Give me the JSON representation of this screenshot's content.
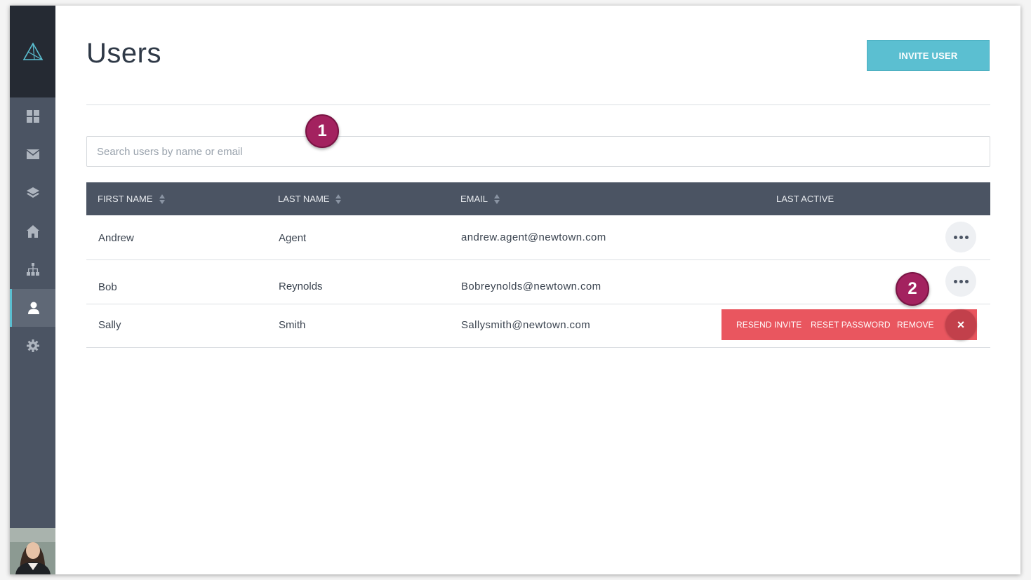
{
  "page": {
    "title": "Users"
  },
  "header": {
    "invite_label": "INVITE USER"
  },
  "search": {
    "placeholder": "Search users by name or email",
    "value": ""
  },
  "table": {
    "columns": [
      "FIRST NAME",
      "LAST NAME",
      "EMAIL",
      "LAST ACTIVE"
    ],
    "rows": [
      {
        "first": "Andrew",
        "last": "Agent",
        "email": "andrew.agent@newtown.com",
        "last_active": ""
      },
      {
        "first": "Bob",
        "last": "Reynolds",
        "email": "Bobreynolds@newtown.com",
        "last_active": ""
      },
      {
        "first": "Sally",
        "last": "Smith",
        "email": "Sallysmith@newtown.com",
        "last_active": ""
      }
    ]
  },
  "row_actions": {
    "resend": "RESEND INVITE",
    "reset": "RESET PASSWORD",
    "remove": "REMOVE",
    "close": "×"
  },
  "markers": [
    "1",
    "2"
  ],
  "sidebar": {
    "items": [
      "dashboard-icon",
      "mail-icon",
      "layers-icon",
      "home-icon",
      "org-chart-icon",
      "user-icon",
      "gear-icon"
    ],
    "active_item": "user-icon"
  },
  "colors": {
    "sidebar": "#4b5463",
    "sidebar_top": "#252a33",
    "accent": "#5bbfd1",
    "danger": "#e9565f",
    "marker": "#a3225f"
  }
}
